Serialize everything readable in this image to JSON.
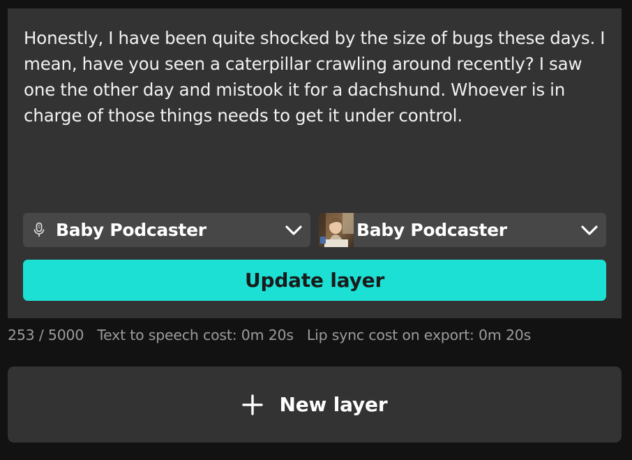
{
  "editor": {
    "script_text": "Honestly, I have been quite shocked by the size of bugs these days. I mean, have you seen a caterpillar crawling around recently? I saw one the other day and mistook it for a dachshund. Whoever is in charge of those things needs to get it under control.",
    "voice_dropdown": {
      "icon": "microphone-icon",
      "selected_label": "Baby Podcaster"
    },
    "avatar_dropdown": {
      "icon": "avatar-thumbnail",
      "selected_label": "Baby Podcaster"
    },
    "update_button_label": "Update layer"
  },
  "stats": {
    "char_count": "253 / 5000",
    "tts_cost": "Text to speech cost: 0m 20s",
    "lip_sync_cost": "Lip sync cost on export: 0m 20s"
  },
  "new_layer_button": {
    "label": "New layer",
    "icon": "plus-icon"
  },
  "colors": {
    "background": "#121212",
    "card": "#333333",
    "dropdown": "#474747",
    "accent": "#1ce0d4",
    "muted_text": "#9c9c9c"
  }
}
